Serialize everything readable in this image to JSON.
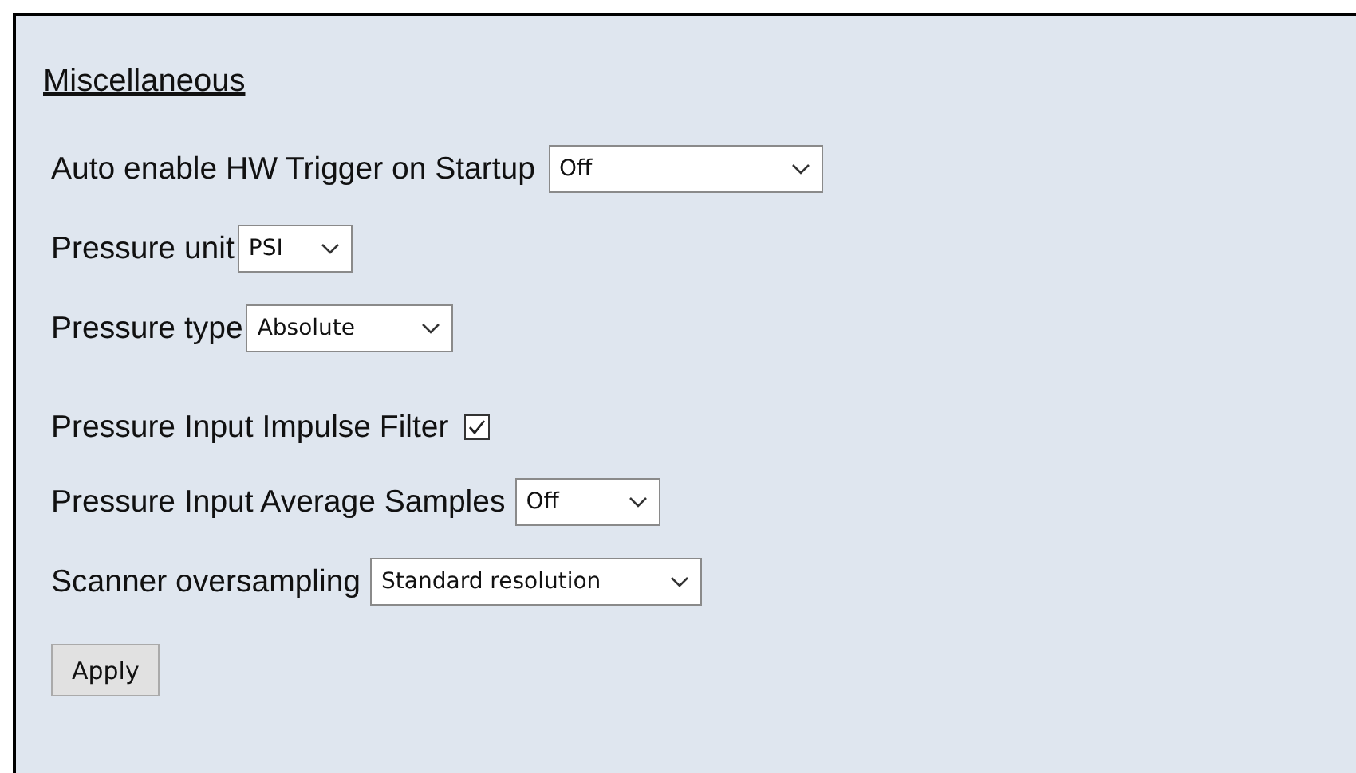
{
  "section": {
    "title": "Miscellaneous"
  },
  "settings": [
    {
      "kind": "select",
      "label": "Auto enable HW Trigger on Startup",
      "value": "Off"
    },
    {
      "kind": "select",
      "label": "Pressure unit",
      "value": "PSI"
    },
    {
      "kind": "select",
      "label": "Pressure type",
      "value": "Absolute"
    },
    {
      "kind": "checkbox",
      "label": "Pressure Input Impulse Filter",
      "checked": true
    },
    {
      "kind": "select",
      "label": "Pressure Input Average Samples",
      "value": "Off"
    },
    {
      "kind": "select",
      "label": "Scanner oversampling",
      "value": "Standard resolution"
    }
  ],
  "buttons": [
    "Apply"
  ]
}
